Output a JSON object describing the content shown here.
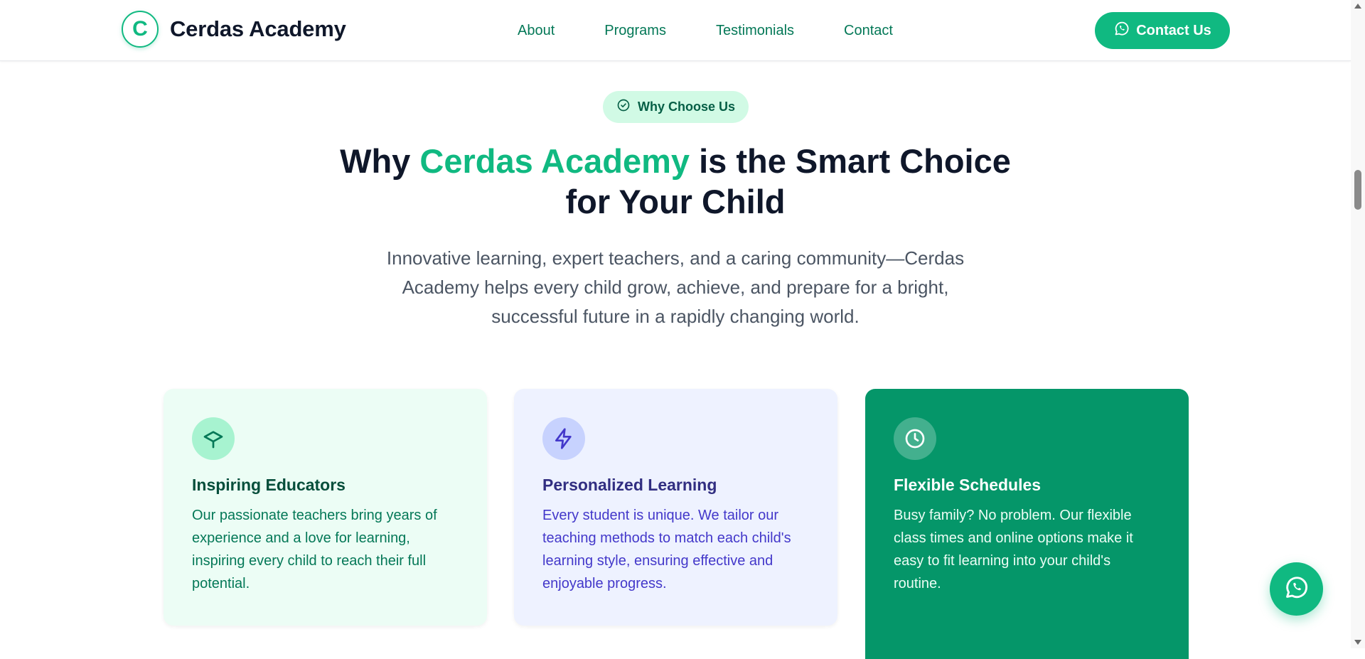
{
  "header": {
    "logo_letter": "C",
    "brand_name": "Cerdas Academy",
    "nav": [
      {
        "label": "About"
      },
      {
        "label": "Programs"
      },
      {
        "label": "Testimonials"
      },
      {
        "label": "Contact"
      }
    ],
    "cta_label": "Contact Us",
    "cta_icon": "whatsapp-icon"
  },
  "section": {
    "badge_icon": "check-circle-icon",
    "badge_label": "Why Choose Us",
    "headline_before": "Why ",
    "headline_accent": "Cerdas Academy",
    "headline_after": " is the Smart Choice for Your Child",
    "lead": "Innovative learning, expert teachers, and a caring community—Cerdas Academy helps every child grow, achieve, and prepare for a bright, successful future in a rapidly changing world."
  },
  "cards": [
    {
      "icon": "graduation-cap-icon",
      "title": "Inspiring Educators",
      "text": "Our passionate teachers bring years of experience and a love for learning, inspiring every child to reach their full potential."
    },
    {
      "icon": "lightning-icon",
      "title": "Personalized Learning",
      "text": "Every student is unique. We tailor our teaching methods to match each child's learning style, ensuring effective and enjoyable progress."
    },
    {
      "icon": "clock-icon",
      "title": "Flexible Schedules",
      "text": "Busy family? No problem. Our flexible class times and online options make it easy to fit learning into your child's routine."
    }
  ],
  "fab_icon": "whatsapp-icon",
  "colors": {
    "primary": "#10b981",
    "primary_dark": "#059669",
    "nav_text": "#047857",
    "heading": "#0f172a",
    "indigo_text": "#4338ca"
  }
}
